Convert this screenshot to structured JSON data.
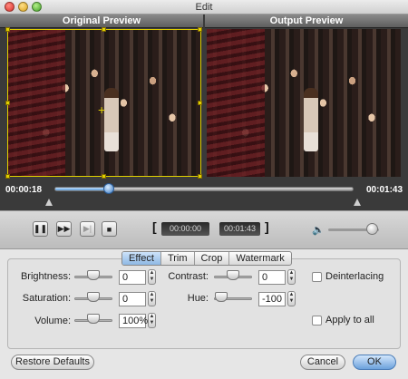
{
  "window": {
    "title": "Edit"
  },
  "preview": {
    "original_label": "Original Preview",
    "output_label": "Output Preview"
  },
  "timeline": {
    "start_time": "00:00:18",
    "end_time": "00:01:43",
    "progress": 0.18
  },
  "playback": {
    "pause_icon": "pause-icon",
    "forward_icon": "fast-forward-icon",
    "next_frame_icon": "next-frame-icon",
    "stop_icon": "stop-icon",
    "trim_start": "00:00:00",
    "trim_end": "00:01:43",
    "volume_level": 0.85
  },
  "tabs": [
    "Effect",
    "Trim",
    "Crop",
    "Watermark"
  ],
  "selected_tab": "Effect",
  "effect": {
    "brightness_label": "Brightness:",
    "brightness_value": "0",
    "saturation_label": "Saturation:",
    "saturation_value": "0",
    "volume_label": "Volume:",
    "volume_value": "100%",
    "contrast_label": "Contrast:",
    "contrast_value": "0",
    "hue_label": "Hue:",
    "hue_value": "-100",
    "deinterlacing_label": "Deinterlacing",
    "apply_all_label": "Apply to all"
  },
  "footer": {
    "restore_label": "Restore Defaults",
    "cancel_label": "Cancel",
    "ok_label": "OK"
  },
  "colors": {
    "accent": "#5b9ad8",
    "crop_frame": "#e0d000"
  }
}
